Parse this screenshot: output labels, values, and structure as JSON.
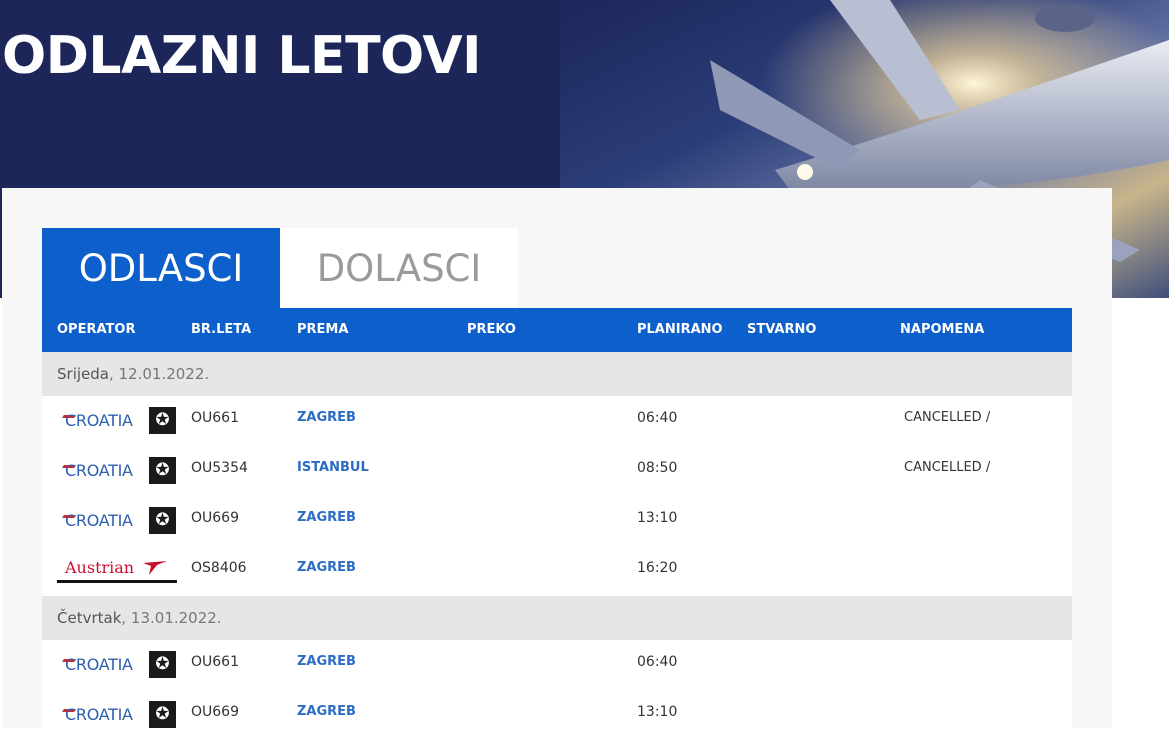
{
  "header": {
    "title": "ODLAZNI LETOVI"
  },
  "tabs": [
    {
      "label": "ODLASCI"
    },
    {
      "label": "DOLASCI"
    }
  ],
  "table": {
    "columns": [
      "OPERATOR",
      "BR.LETA",
      "PREMA",
      "PREKO",
      "PLANIRANO",
      "STVARNO",
      "NAPOMENA"
    ],
    "groups": [
      {
        "day": "Srijeda",
        "date": ", 12.01.2022.",
        "flights": [
          {
            "operator": "CROATIA",
            "flight": "OU661",
            "to": "ZAGREB",
            "via": "",
            "planned": "06:40",
            "actual": "",
            "note": "CANCELLED /"
          },
          {
            "operator": "CROATIA",
            "flight": "OU5354",
            "to": "ISTANBUL",
            "via": "",
            "planned": "08:50",
            "actual": "",
            "note": "CANCELLED /"
          },
          {
            "operator": "CROATIA",
            "flight": "OU669",
            "to": "ZAGREB",
            "via": "",
            "planned": "13:10",
            "actual": "",
            "note": ""
          },
          {
            "operator": "Austrian",
            "flight": "OS8406",
            "to": "ZAGREB",
            "via": "",
            "planned": "16:20",
            "actual": "",
            "note": ""
          }
        ]
      },
      {
        "day": "Četvrtak",
        "date": ", 13.01.2022.",
        "flights": [
          {
            "operator": "CROATIA",
            "flight": "OU661",
            "to": "ZAGREB",
            "via": "",
            "planned": "06:40",
            "actual": "",
            "note": ""
          },
          {
            "operator": "CROATIA",
            "flight": "OU669",
            "to": "ZAGREB",
            "via": "",
            "planned": "13:10",
            "actual": "",
            "note": ""
          }
        ]
      }
    ]
  },
  "colors": {
    "header_bg": "#1c2659",
    "accent_blue": "#0d5fcb",
    "link_blue": "#2b6cc4",
    "croatia_blue": "#2c5fae",
    "austrian_red": "#c8102e"
  }
}
